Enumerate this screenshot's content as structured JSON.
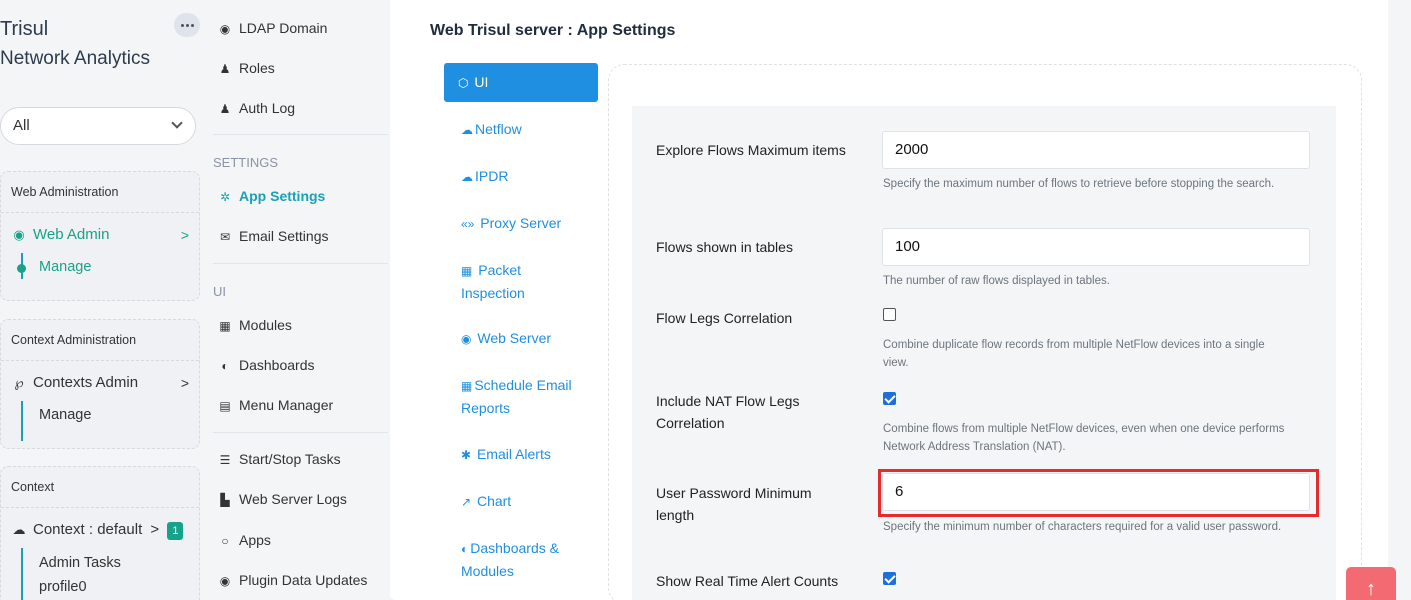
{
  "brand": {
    "line1": "Trisul",
    "line2": "Network Analytics"
  },
  "context_select": {
    "value": "All"
  },
  "web_admin_card": {
    "header": "Web Administration",
    "item": "Web Admin",
    "arrow": ">",
    "sub": "Manage"
  },
  "context_admin_card": {
    "header": "Context Administration",
    "item": "Contexts Admin",
    "arrow": ">",
    "sub": "Manage"
  },
  "context_card": {
    "header": "Context",
    "item": "Context : default",
    "arrow": ">",
    "badge": "1",
    "sub1": "Admin Tasks",
    "sub2": "profile0"
  },
  "menu2": {
    "ldap": "LDAP Domain",
    "roles": "Roles",
    "auth_log": "Auth Log",
    "settings_section": "SETTINGS",
    "app_settings": "App Settings",
    "email_settings": "Email Settings",
    "ui_section": "UI",
    "modules": "Modules",
    "dashboards": "Dashboards",
    "menu_manager": "Menu Manager",
    "start_stop": "Start/Stop Tasks",
    "web_server_logs": "Web Server Logs",
    "apps": "Apps",
    "plugin_updates": "Plugin Data Updates"
  },
  "main": {
    "title": "Web Trisul server : App Settings",
    "tabs": {
      "ui": "UI",
      "netflow": "Netflow",
      "ipdr": "IPDR",
      "proxy": "Proxy Server",
      "packet1": "Packet",
      "packet2": "Inspection",
      "web_server": "Web Server",
      "schedule1": "Schedule Email",
      "schedule2": "Reports",
      "email_alerts": "Email Alerts",
      "chart": "Chart",
      "dash1": "Dashboards &",
      "dash2": "Modules"
    },
    "settings": {
      "explore_label": "Explore Flows Maximum items",
      "explore_value": "2000",
      "explore_help": "Specify the maximum number of flows to retrieve before stopping the search.",
      "flows_label": "Flows shown in tables",
      "flows_value": "100",
      "flows_help": "The number of raw flows displayed in tables.",
      "legs_label": "Flow Legs Correlation",
      "legs_checked": false,
      "legs_help": "Combine duplicate flow records from multiple NetFlow devices into a single view.",
      "nat_label1": "Include NAT Flow Legs",
      "nat_label2": "Correlation",
      "nat_checked": true,
      "nat_help": "Combine flows from multiple NetFlow devices, even when one device performs Network Address Translation (NAT).",
      "pwd_label1": "User Password Minimum",
      "pwd_label2": "length",
      "pwd_value": "6",
      "pwd_help": "Specify the minimum number of characters required for a valid user password.",
      "rt_label": "Show Real Time Alert Counts",
      "rt_checked": true
    }
  },
  "colors": {
    "accent": "#1e8fe1",
    "teal": "#17a38a",
    "highlight": "#e52b2b",
    "to_top": "#f36a72"
  }
}
